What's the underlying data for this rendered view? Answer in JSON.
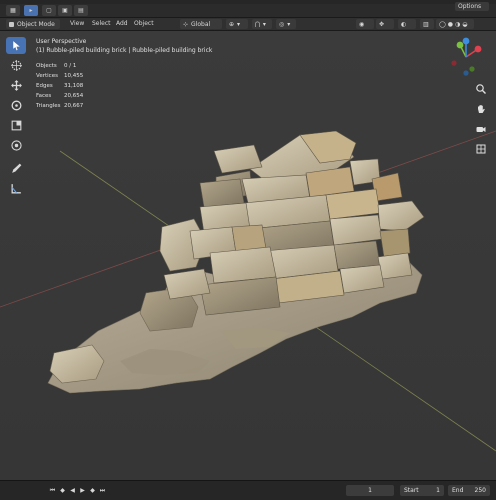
{
  "header": {
    "mode_label": "Object Mode",
    "menus": [
      "View",
      "Select",
      "Add",
      "Object"
    ],
    "orientation_label": "Global",
    "options_label": "Options"
  },
  "viewport": {
    "view_name": "User Perspective",
    "object_path": "(1) Rubble-piled building brick | Rubble-piled building brick",
    "stats": [
      {
        "label": "Objects",
        "value": "0 / 1"
      },
      {
        "label": "Vertices",
        "value": "10,455"
      },
      {
        "label": "Edges",
        "value": "31,108"
      },
      {
        "label": "Faces",
        "value": "20,654"
      },
      {
        "label": "Triangles",
        "value": "20,667"
      }
    ]
  },
  "gizmo": {
    "axis_x_color": "#e0414f",
    "axis_y_color": "#7bc241",
    "axis_z_color": "#3d8ee0"
  },
  "tools": [
    "select-box-icon",
    "cursor-icon",
    "move-icon",
    "rotate-icon",
    "scale-icon",
    "transform-icon",
    "annotate-icon",
    "measure-icon"
  ],
  "timeline": {
    "current_frame": "1",
    "start_label": "Start",
    "start_value": "1",
    "end_label": "End",
    "end_value": "250"
  }
}
